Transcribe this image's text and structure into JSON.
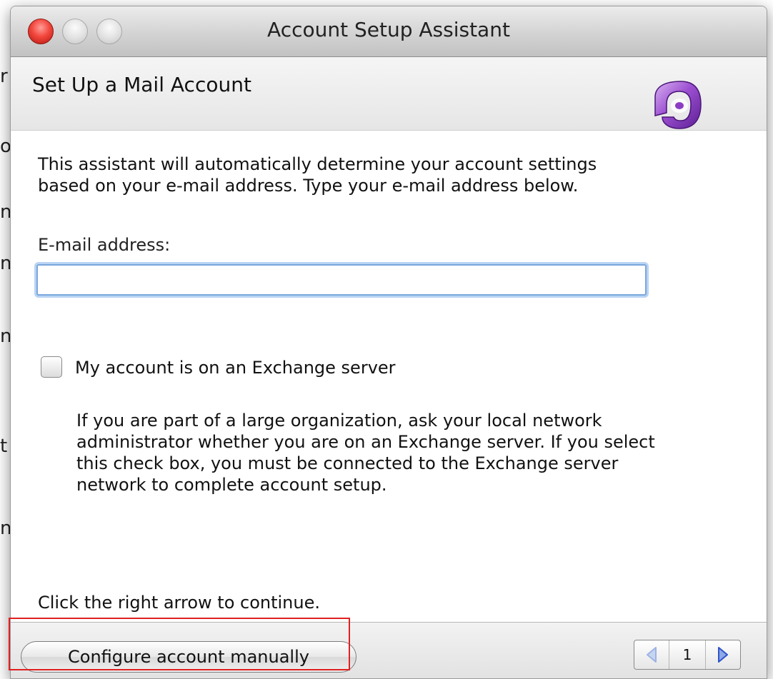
{
  "window": {
    "title": "Account Setup Assistant"
  },
  "header": {
    "title": "Set Up a Mail Account",
    "icon": "entourage-app-icon"
  },
  "main": {
    "intro_line1": "This assistant will automatically determine your account settings",
    "intro_line2": "based on your e-mail address. Type your e-mail address below.",
    "email_label": "E-mail address:",
    "email_value": "",
    "exchange_checkbox_label": "My account is on an Exchange server",
    "exchange_checked": false,
    "help_line1": "If you are part of a large organization, ask your local network",
    "help_line2": "administrator whether you are on an Exchange server. If you select",
    "help_line3": "this check box, you must be connected to the Exchange server",
    "help_line4": "network to complete account setup.",
    "continue_hint": "Click the right arrow to continue."
  },
  "footer": {
    "manual_button_label": "Configure account manually",
    "page_number": "1",
    "prev_icon": "left-arrow-icon",
    "next_icon": "right-arrow-icon"
  },
  "colors": {
    "close_button": "#f2473d",
    "focus_ring": "#7aa7dd",
    "highlight_outline": "#e02020",
    "icon_purple": "#8d3fc4",
    "next_arrow": "#2f55c8",
    "prev_arrow": "#9db3e4"
  }
}
